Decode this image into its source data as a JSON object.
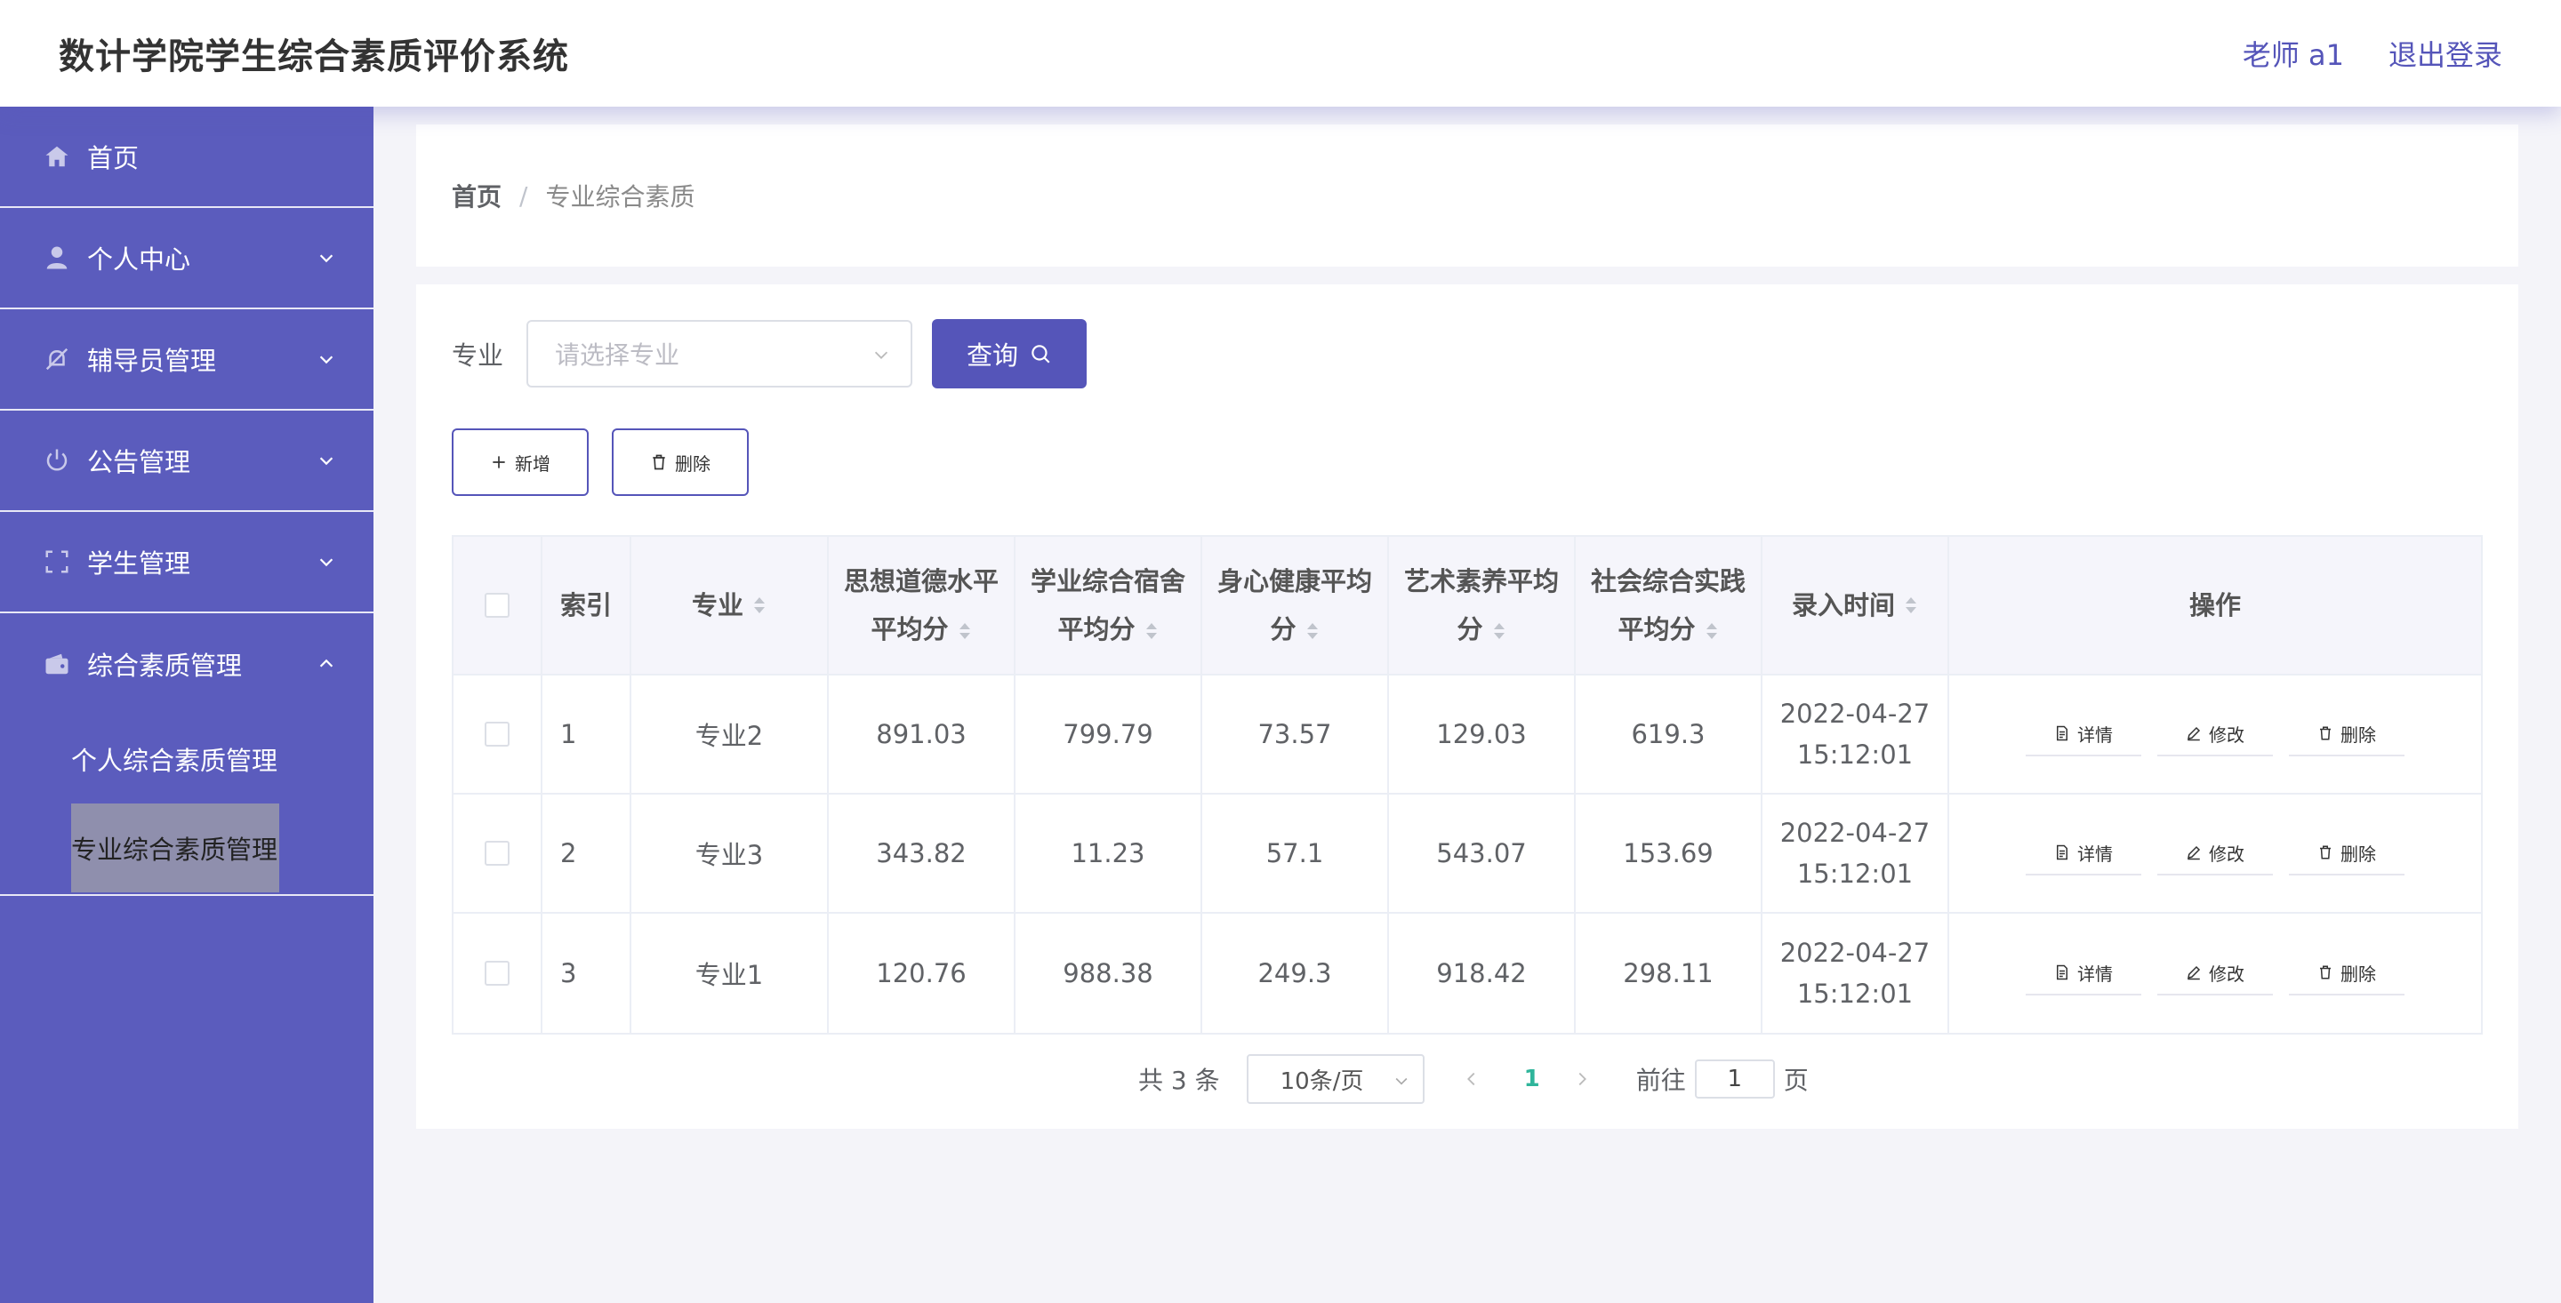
{
  "header": {
    "title": "数计学院学生综合素质评价系统",
    "user": "老师 a1",
    "logout": "退出登录"
  },
  "sidebar": {
    "items": [
      {
        "label": "首页",
        "icon": "home-icon"
      },
      {
        "label": "个人中心",
        "icon": "user-icon"
      },
      {
        "label": "辅导员管理",
        "icon": "bell-off-icon"
      },
      {
        "label": "公告管理",
        "icon": "power-icon"
      },
      {
        "label": "学生管理",
        "icon": "scan-icon"
      },
      {
        "label": "综合素质管理",
        "icon": "wallet-icon"
      }
    ],
    "sub_items": [
      {
        "label": "个人综合素质管理"
      },
      {
        "label": "专业综合素质管理"
      }
    ]
  },
  "breadcrumb": {
    "home": "首页",
    "separator": "/",
    "current": "专业综合素质"
  },
  "search": {
    "label": "专业",
    "placeholder": "请选择专业",
    "button": "查询"
  },
  "actions": {
    "add": "新增",
    "delete": "删除"
  },
  "table": {
    "headers": {
      "index": "索引",
      "major": "专业",
      "moral_1": "思想道德水平",
      "moral_2": "平均分",
      "dorm_1": "学业综合宿舍",
      "dorm_2": "平均分",
      "health_1": "身心健康平均",
      "health_2": "分",
      "art_1": "艺术素养平均",
      "art_2": "分",
      "social_1": "社会综合实践",
      "social_2": "平均分",
      "time": "录入时间",
      "ops": "操作"
    },
    "rows": [
      {
        "index": "1",
        "major": "专业2",
        "moral": "891.03",
        "dorm": "799.79",
        "health": "73.57",
        "art": "129.03",
        "social": "619.3",
        "date": "2022-04-27",
        "clock": "15:12:01"
      },
      {
        "index": "2",
        "major": "专业3",
        "moral": "343.82",
        "dorm": "11.23",
        "health": "57.1",
        "art": "543.07",
        "social": "153.69",
        "date": "2022-04-27",
        "clock": "15:12:01"
      },
      {
        "index": "3",
        "major": "专业1",
        "moral": "120.76",
        "dorm": "988.38",
        "health": "249.3",
        "art": "918.42",
        "social": "298.11",
        "date": "2022-04-27",
        "clock": "15:12:01"
      }
    ],
    "row_ops": {
      "detail": "详情",
      "edit": "修改",
      "delete": "删除"
    }
  },
  "pagination": {
    "total": "共 3 条",
    "page_size": "10条/页",
    "current_page": "1",
    "goto_label": "前往",
    "goto_value": "1",
    "page_unit": "页"
  },
  "colors": {
    "primary": "#5555b9",
    "sidebar": "#5b5cbd",
    "page_active": "#2fb59b"
  }
}
